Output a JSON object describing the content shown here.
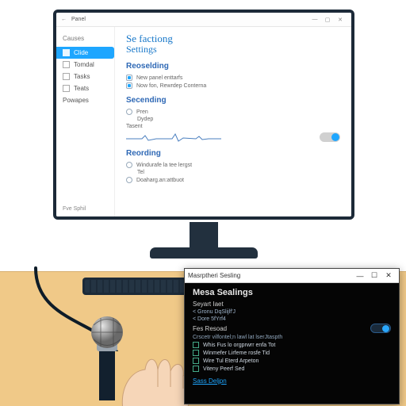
{
  "main_window": {
    "titlebar": {
      "back_glyph": "←",
      "title": "Panel",
      "min": "—",
      "max": "▢",
      "close": "✕"
    },
    "sidebar": {
      "heading": "Causes",
      "items": [
        {
          "label": "Clide",
          "active": true
        },
        {
          "label": "Tomdal"
        },
        {
          "label": "Tasks"
        },
        {
          "label": "Teats"
        },
        {
          "label": "Powapes"
        }
      ]
    },
    "content": {
      "title_a": "Se factiong",
      "title_b": "Settings",
      "section1": {
        "title": "Reoselding",
        "opt1": "New panel enttarfs",
        "opt2": "Now fon, Rewrdep Conterna"
      },
      "section2": {
        "title": "Secending",
        "radio_label": "Pren",
        "radio_sub": "Dydep",
        "level_label": "Tasent"
      },
      "section3": {
        "title": "Reording",
        "opt1": "Windurafe la tee lergst",
        "opt1b": "Tel",
        "opt2": "Doaharg.an:attbuot"
      },
      "footer": "Fve Sphil"
    }
  },
  "dialog": {
    "titlebar": {
      "title": "Masrptheri Sesling",
      "min": "—",
      "max": "☐",
      "close": "✕"
    },
    "heading": "Mesa Sealings",
    "group1_label": "Seyart Iaet",
    "group1_line1": "< Gronu  DqSlijlf'J",
    "group1_line2": "< Dore  5fYrf4",
    "group2_label": "Fes Resoad",
    "toggle_row": "Crscetr vilfontel;n lawl lat lserJtaspth",
    "check1": "Whis Fus lo orgprwrr enfa Tot",
    "check2": "Winmefer Lirfeme rosfe Tid",
    "check3": "Wire Tul Eterd Arpeton",
    "check4": "Viteny Peerf Sed",
    "link": "Sass Deljpn"
  }
}
